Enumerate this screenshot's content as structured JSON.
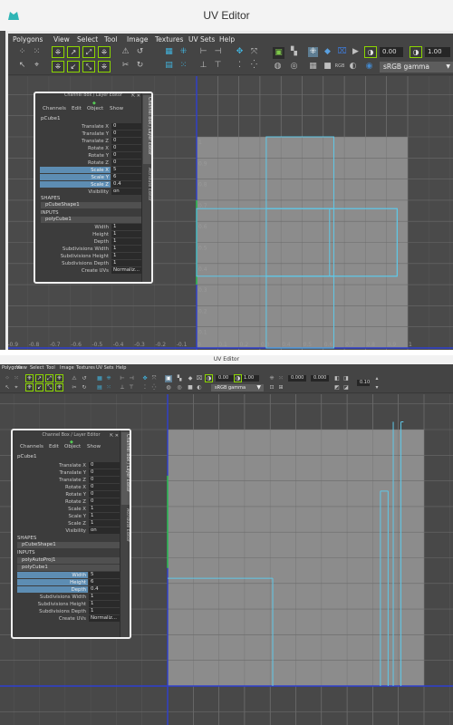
{
  "top": {
    "window_title": "UV Editor",
    "menu": [
      "Polygons",
      "View",
      "Select",
      "Tool",
      "Image",
      "Textures",
      "UV Sets",
      "Help"
    ],
    "toolbar": {
      "exposure_value": "0.00",
      "gamma_value": "1.00",
      "colorspace": "sRGB gamma",
      "colorspace_tag": "RGB"
    },
    "axis_labels_x": [
      "-1",
      "-0.9",
      "-0.8",
      "-0.7",
      "-0.6",
      "-0.5",
      "-0.4",
      "-0.3",
      "-0.2",
      "-0.1",
      "0",
      "0.1",
      "0.2",
      "0.3",
      "0.4",
      "0.5",
      "0.6",
      "0.7",
      "0.8",
      "0.9",
      "1"
    ],
    "axis_labels_y": [
      "1",
      "0.9",
      "0.8",
      "0.7",
      "0.6",
      "0.5",
      "0.4",
      "0.3",
      "0.2",
      "0.1",
      "-0.1"
    ],
    "channel_box": {
      "title": "Channel Box / Layer Editor",
      "menu": [
        "Channels",
        "Edit",
        "Object",
        "Show"
      ],
      "object": "pCube1",
      "attributes": [
        {
          "label": "Translate X",
          "value": "0",
          "highlight": false
        },
        {
          "label": "Translate Y",
          "value": "0",
          "highlight": false
        },
        {
          "label": "Translate Z",
          "value": "0",
          "highlight": false
        },
        {
          "label": "Rotate X",
          "value": "0",
          "highlight": false
        },
        {
          "label": "Rotate Y",
          "value": "0",
          "highlight": false
        },
        {
          "label": "Rotate Z",
          "value": "0",
          "highlight": false
        },
        {
          "label": "Scale X",
          "value": "5",
          "highlight": true
        },
        {
          "label": "Scale Y",
          "value": "6",
          "highlight": true
        },
        {
          "label": "Scale Z",
          "value": "0.4",
          "highlight": true
        },
        {
          "label": "Visibility",
          "value": "on",
          "highlight": false
        }
      ],
      "shapes_header": "SHAPES",
      "shape_node": "pCubeShape1",
      "inputs_header": "INPUTS",
      "input_node": "polyCube1",
      "inputs": [
        {
          "label": "Width",
          "value": "1"
        },
        {
          "label": "Height",
          "value": "1"
        },
        {
          "label": "Depth",
          "value": "1"
        },
        {
          "label": "Subdivisions Width",
          "value": "1"
        },
        {
          "label": "Subdivisions Height",
          "value": "1"
        },
        {
          "label": "Subdivisions Depth",
          "value": "1"
        },
        {
          "label": "Create UVs",
          "value": "Normaliz..."
        }
      ],
      "side_tabs": [
        "Channel Box / Layer Editor",
        "Attribute Editor"
      ]
    }
  },
  "bottom": {
    "window_title": "UV Editor",
    "menu": [
      "Polygons",
      "View",
      "Select",
      "Tool",
      "Image",
      "Textures",
      "UV Sets",
      "Help"
    ],
    "toolbar": {
      "exposure_value": "0.00",
      "gamma_value": "1.00",
      "colorspace": "sRGB gamma",
      "extra_value_1": "0.000",
      "extra_value_2": "0.000",
      "step_value": "0.10"
    },
    "channel_box": {
      "title": "Channel Box / Layer Editor",
      "menu": [
        "Channels",
        "Edit",
        "Object",
        "Show"
      ],
      "object": "pCube1",
      "attributes": [
        {
          "label": "Translate X",
          "value": "0"
        },
        {
          "label": "Translate Y",
          "value": "0"
        },
        {
          "label": "Translate Z",
          "value": "0"
        },
        {
          "label": "Rotate X",
          "value": "0"
        },
        {
          "label": "Rotate Y",
          "value": "0"
        },
        {
          "label": "Rotate Z",
          "value": "0"
        },
        {
          "label": "Scale X",
          "value": "1"
        },
        {
          "label": "Scale Y",
          "value": "1"
        },
        {
          "label": "Scale Z",
          "value": "1"
        },
        {
          "label": "Visibility",
          "value": "on"
        }
      ],
      "shapes_header": "SHAPES",
      "shape_node": "pCubeShape1",
      "inputs_header": "INPUTS",
      "input_node_1": "polyAutoProj1",
      "input_node_2": "polyCube1",
      "inputs": [
        {
          "label": "Width",
          "value": "5",
          "highlight": true
        },
        {
          "label": "Height",
          "value": "6",
          "highlight": true
        },
        {
          "label": "Depth",
          "value": "0.4",
          "highlight": true
        },
        {
          "label": "Subdivisions Width",
          "value": "1",
          "highlight": false
        },
        {
          "label": "Subdivisions Height",
          "value": "1",
          "highlight": false
        },
        {
          "label": "Subdivisions Depth",
          "value": "1",
          "highlight": false
        },
        {
          "label": "Create UVs",
          "value": "Normaliz...",
          "highlight": false
        }
      ],
      "side_tabs": [
        "Channel Box / Layer Editor",
        "Attribute Editor"
      ]
    }
  },
  "colors": {
    "uv_shell_outline": "#5fc8e8",
    "selection_highlight": "#5d8db3",
    "uv_tile": "#8c8c8c",
    "toggle_green": "#8cd600",
    "v_axis": "#2e3fcf",
    "u_axis_green": "#2ecc40"
  }
}
